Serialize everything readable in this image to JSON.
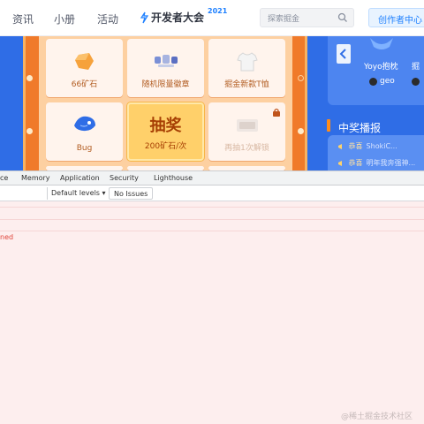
{
  "nav": {
    "links": [
      "资讯",
      "小册",
      "活动"
    ],
    "logo_text": "开发者大会",
    "logo_year": "2021",
    "search_placeholder": "探索掘金",
    "creator_button": "创作者中心"
  },
  "lottery": {
    "prizes": [
      {
        "label": "66矿石",
        "icon": "ore-icon"
      },
      {
        "label": "随机限量徽章",
        "icon": "badge-set-icon"
      },
      {
        "label": "掘金新款T恤",
        "icon": "tshirt-icon"
      },
      {
        "label": "Bug",
        "icon": "bug-icon"
      },
      {
        "label": "再抽1次解锁",
        "icon": "locked-prize-icon",
        "locked": true
      }
    ],
    "draw": {
      "title": "抽奖",
      "cost": "200矿石/次"
    }
  },
  "sidebar": {
    "card_names": [
      "Yoyo抱枕",
      "掘"
    ],
    "users": [
      "geo"
    ],
    "winners_title": "中奖播报",
    "winners": [
      {
        "name": "恭喜",
        "text": "ShokiC..."
      },
      {
        "name": "恭喜",
        "text": "明年我奔强神..."
      }
    ]
  },
  "devtools": {
    "tabs": [
      "ce",
      "Memory",
      "Application",
      "Security",
      "Lighthouse"
    ],
    "levels": "Default levels ▾",
    "issues": "No Issues",
    "error_fragment": "ned"
  },
  "watermark": "@稀土掘金技术社区",
  "colors": {
    "accent": "#1e80ff",
    "board": "#f07a2a",
    "sidebar": "#2f6de6",
    "console_error_bg": "#fdeeee"
  }
}
